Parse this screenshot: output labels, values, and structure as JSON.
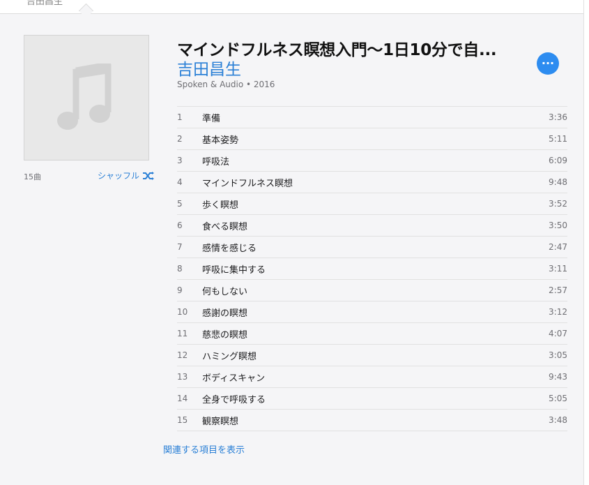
{
  "topbar": {
    "tab_label": "吉田昌生"
  },
  "album": {
    "title": "マインドフルネス瞑想入門〜1日10分で自...",
    "artist": "吉田昌生",
    "meta": "Spoken & Audio • 2016",
    "track_count": "15曲",
    "shuffle_label": "シャッフル",
    "more_label": "···"
  },
  "tracks": [
    {
      "num": "1",
      "name": "準備",
      "duration": "3:36"
    },
    {
      "num": "2",
      "name": "基本姿勢",
      "duration": "5:11"
    },
    {
      "num": "3",
      "name": "呼吸法",
      "duration": "6:09"
    },
    {
      "num": "4",
      "name": "マインドフルネス瞑想",
      "duration": "9:48"
    },
    {
      "num": "5",
      "name": "歩く瞑想",
      "duration": "3:52"
    },
    {
      "num": "6",
      "name": "食べる瞑想",
      "duration": "3:50"
    },
    {
      "num": "7",
      "name": "感情を感じる",
      "duration": "2:47"
    },
    {
      "num": "8",
      "name": "呼吸に集中する",
      "duration": "3:11"
    },
    {
      "num": "9",
      "name": "何もしない",
      "duration": "2:57"
    },
    {
      "num": "10",
      "name": "感謝の瞑想",
      "duration": "3:12"
    },
    {
      "num": "11",
      "name": "慈悲の瞑想",
      "duration": "4:07"
    },
    {
      "num": "12",
      "name": "ハミング瞑想",
      "duration": "3:05"
    },
    {
      "num": "13",
      "name": "ボディスキャン",
      "duration": "9:43"
    },
    {
      "num": "14",
      "name": "全身で呼吸する",
      "duration": "5:05"
    },
    {
      "num": "15",
      "name": "観察瞑想",
      "duration": "3:48"
    }
  ],
  "related_link": "関連する項目を表示",
  "colors": {
    "accent": "#2b80d6",
    "button": "#2d8cf0",
    "background": "#f5f5f7"
  },
  "icons": {
    "artwork": "music-note-icon",
    "shuffle": "shuffle-icon",
    "more": "more-icon"
  }
}
